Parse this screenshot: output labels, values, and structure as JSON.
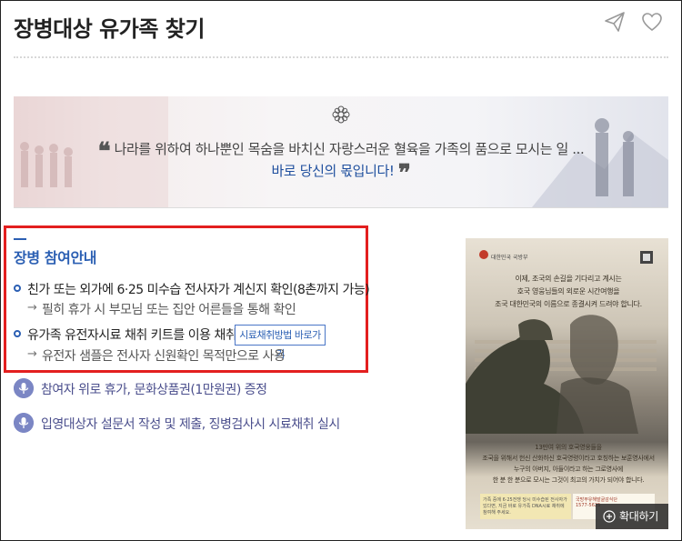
{
  "header": {
    "title": "장병대상 유가족 찾기"
  },
  "banner": {
    "line1": "나라를 위하여 하나뿐인 목숨을 바치신 자랑스러운 혈육을 가족의 품으로 모시는 일 ...",
    "line2": "바로 당신의 몫입니다!"
  },
  "guide": {
    "title": "장병 참여안내",
    "items": [
      {
        "text": "친가 또는 외가에 6·25 미수습 전사자가 계신지 확인(8촌까지 가능)",
        "sub": "필히 휴가 시 부모님 또는 집안 어른들을 통해 확인"
      },
      {
        "text": "유가족 유전자시료 채취 키트를 이용 채취",
        "sub": "유전자 샘플은 전사자 신원확인 목적만으로 사용"
      }
    ],
    "link_button": "시료채취방법 바로가기",
    "sub_arrow": "→"
  },
  "benefits": [
    "참여자 위로 휴가, 문화상품권(1만원권) 증정",
    "입영대상자 설문서 작성 및 제출, 징병검사시 시료채취 실시"
  ],
  "poster": {
    "org": "대한민국 국방부",
    "headline_lines": [
      "이제, 조국의 손길을 기다리고 계시는",
      "호국 영웅님들의 외로운 시간여행을",
      "조국 대한민국의 이름으로 종결시켜 드려야 합니다."
    ],
    "caption_lines": [
      "13만여 위의 호국영웅들을",
      "조국을 위해서 헌신 산화하신 호국영령이라고 호칭하는 보훈영사에서",
      "누구의 아버지, 아들이라고 하는 그로영사에",
      "한 분 한 분으로 모시는 그것이 최고의 가치가 되어야 합니다."
    ],
    "contact": "가족 중에 6·25전쟁 당시 미수습된 전사자가 있다면, 지금 바로 유가족 DNA시료 채취에 참여해 주세요.",
    "footer_org": "국방부유해발굴감식단",
    "footer_phone": "1577-5625"
  },
  "enlarge_button": "확대하기",
  "colors": {
    "accent": "#2b5fb3",
    "highlight": "#e31f1f",
    "benefit": "#4a4e8c",
    "mic": "#7b86c4"
  },
  "icons": {
    "share": "paper-plane-icon",
    "like": "heart-icon",
    "decor": "flower-icon",
    "audio": "microphone-icon",
    "enlarge": "plus-circle-icon"
  }
}
